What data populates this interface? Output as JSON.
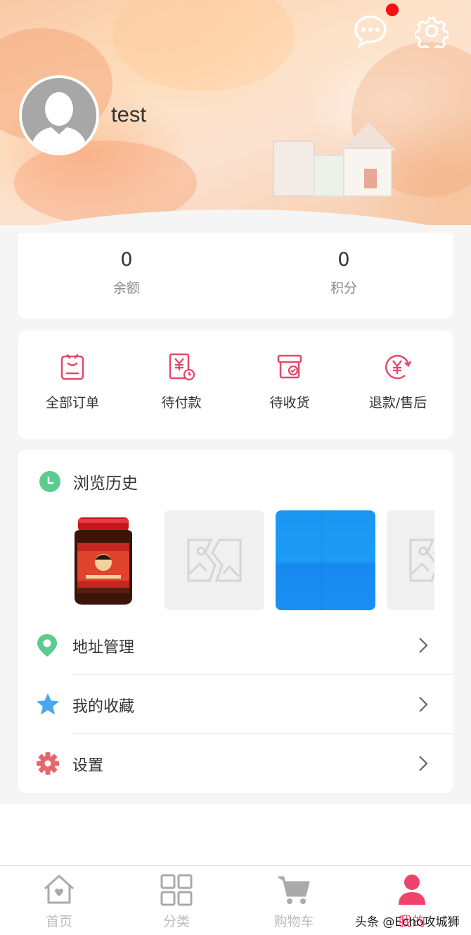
{
  "profile": {
    "username": "test",
    "has_unread_messages": true
  },
  "stats": [
    {
      "value": "0",
      "label": "余额"
    },
    {
      "value": "0",
      "label": "积分"
    }
  ],
  "orders": [
    {
      "label": "全部订单",
      "icon": "order-list-icon"
    },
    {
      "label": "待付款",
      "icon": "pending-payment-icon"
    },
    {
      "label": "待收货",
      "icon": "pending-receipt-icon"
    },
    {
      "label": "退款/售后",
      "icon": "refund-icon"
    }
  ],
  "history": {
    "title": "浏览历史",
    "items": [
      "chili-sauce-jar",
      "placeholder-image",
      "blue-image",
      "placeholder-image"
    ]
  },
  "menu": [
    {
      "label": "地址管理",
      "icon": "location-pin-icon",
      "color": "#5ccb8f"
    },
    {
      "label": "我的收藏",
      "icon": "star-icon",
      "color": "#4aa6ef"
    },
    {
      "label": "设置",
      "icon": "gear-icon",
      "color": "#e4686b"
    }
  ],
  "tabs": [
    {
      "label": "首页",
      "icon": "home-icon"
    },
    {
      "label": "分类",
      "icon": "category-grid-icon"
    },
    {
      "label": "购物车",
      "icon": "cart-icon"
    },
    {
      "label": "我的",
      "icon": "user-icon",
      "active": true
    }
  ],
  "watermark": "头条 @Echo攻城狮",
  "colors": {
    "accent": "#f0436b",
    "icon_pink": "#e8476a",
    "notification": "#f40f12"
  }
}
